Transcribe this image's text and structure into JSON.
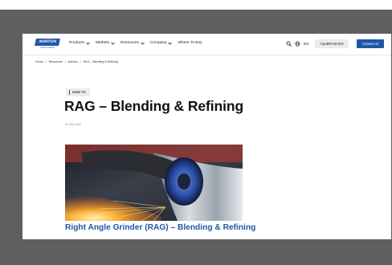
{
  "brand": {
    "logo_text": "NORTON",
    "logo_tagline": "SAINT-GOBAIN"
  },
  "nav": {
    "items": [
      {
        "label": "Products",
        "has_dropdown": true
      },
      {
        "label": "Markets",
        "has_dropdown": true
      },
      {
        "label": "Resources",
        "has_dropdown": true
      },
      {
        "label": "Company",
        "has_dropdown": true
      },
      {
        "label": "Where To Buy",
        "has_dropdown": false
      }
    ],
    "search_icon": "search-icon",
    "globe_icon": "globe-icon",
    "language": "EN",
    "my_abrasives_label": "myABRASIVES",
    "contact_label": "Contact Us"
  },
  "breadcrumb": {
    "items": [
      "Home",
      "Resources",
      "Articles",
      "RAG – Blending & Refining"
    ],
    "separator": "/"
  },
  "article": {
    "tag": "HOW TO",
    "title": "RAG – Blending & Refining",
    "date": "04 Sep 2020",
    "caption": "Right Angle Grinder (RAG) – Blending & Refining"
  },
  "colors": {
    "brand_blue": "#1f56a6",
    "backdrop": "#5f5f5f",
    "page": "#ffffff"
  }
}
